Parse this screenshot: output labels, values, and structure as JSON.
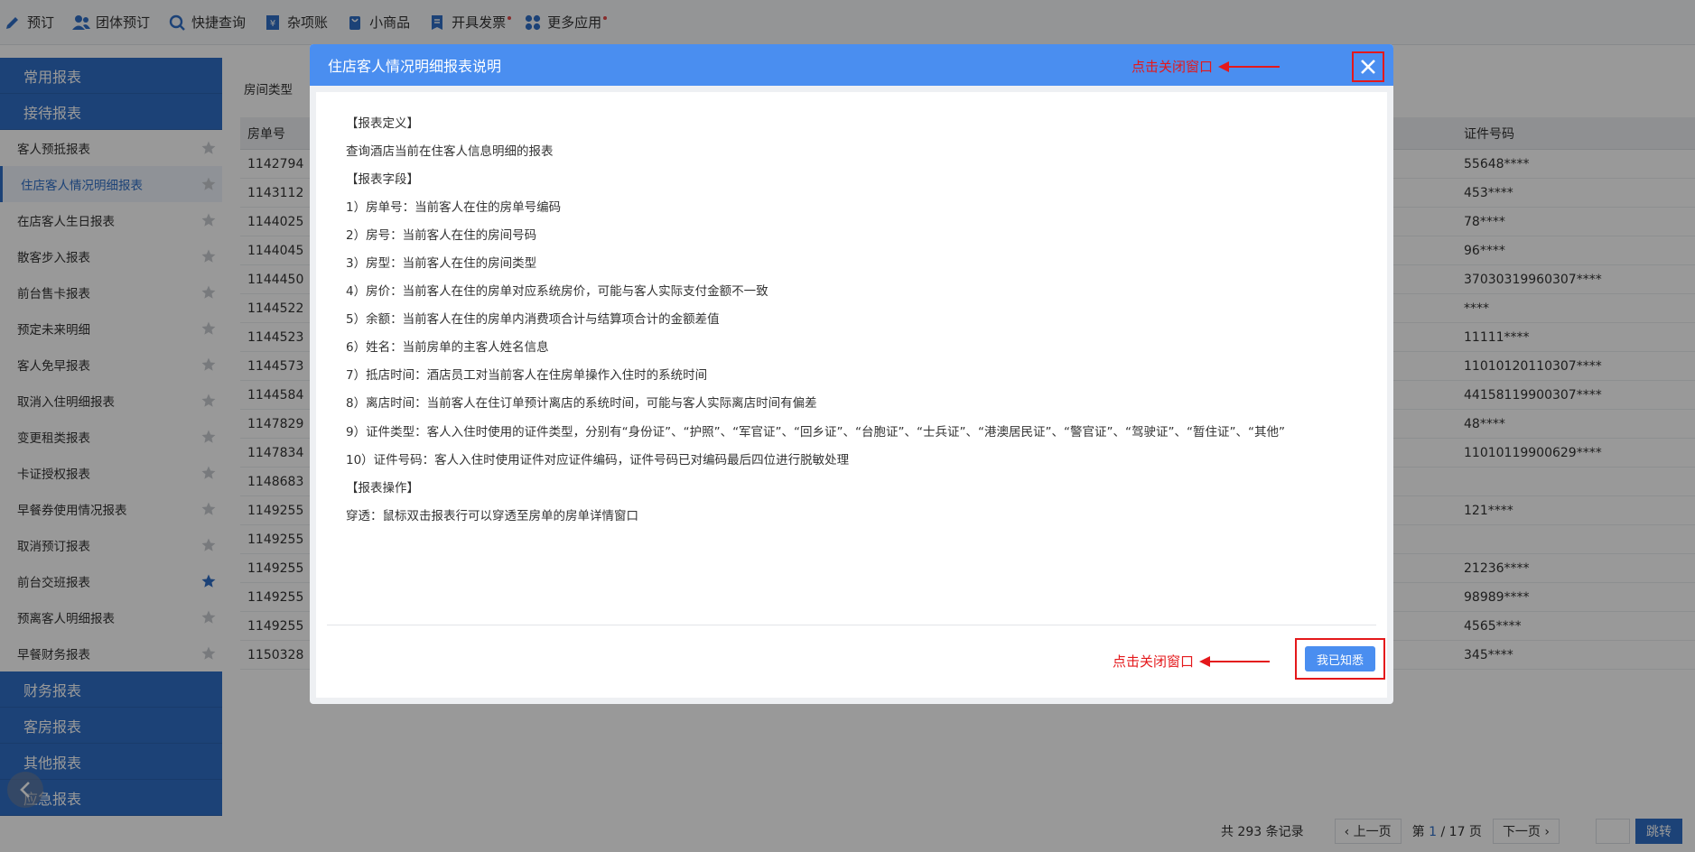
{
  "toolbar": {
    "items": [
      {
        "label": "预订",
        "icon": "pencil-icon"
      },
      {
        "label": "团体预订",
        "icon": "group-icon"
      },
      {
        "label": "快捷查询",
        "icon": "search-icon"
      },
      {
        "label": "杂项账",
        "icon": "ledger-icon"
      },
      {
        "label": "小商品",
        "icon": "bag-icon"
      },
      {
        "label": "开具发票",
        "icon": "invoice-icon"
      },
      {
        "label": "更多应用",
        "icon": "apps-icon"
      }
    ]
  },
  "sidebar": {
    "top_categories": [
      "常用报表",
      "接待报表"
    ],
    "items": [
      {
        "label": "客人预抵报表",
        "starred": false
      },
      {
        "label": "住店客人情况明细报表",
        "starred": false,
        "active": true
      },
      {
        "label": "在店客人生日报表",
        "starred": false
      },
      {
        "label": "散客步入报表",
        "starred": false
      },
      {
        "label": "前台售卡报表",
        "starred": false
      },
      {
        "label": "预定未来明细",
        "starred": false
      },
      {
        "label": "客人免早报表",
        "starred": false
      },
      {
        "label": "取消入住明细报表",
        "starred": false
      },
      {
        "label": "变更租类报表",
        "starred": false
      },
      {
        "label": "卡证授权报表",
        "starred": false
      },
      {
        "label": "早餐券使用情况报表",
        "starred": false
      },
      {
        "label": "取消预订报表",
        "starred": false
      },
      {
        "label": "前台交班报表",
        "starred": true
      },
      {
        "label": "预离客人明细报表",
        "starred": false
      },
      {
        "label": "早餐财务报表",
        "starred": false
      }
    ],
    "bottom_categories": [
      "财务报表",
      "客房报表",
      "其他报表",
      "应急报表"
    ]
  },
  "main": {
    "filter_label": "房间类型",
    "columns": [
      "房单号",
      "证件号码"
    ],
    "rows": [
      [
        "1142794",
        "55648****"
      ],
      [
        "1143112",
        "453****"
      ],
      [
        "1144025",
        "78****"
      ],
      [
        "1144045",
        "96****"
      ],
      [
        "1144450",
        "37030319960307****"
      ],
      [
        "1144522",
        "****"
      ],
      [
        "1144523",
        "11111****"
      ],
      [
        "1144573",
        "11010120110307****"
      ],
      [
        "1144584",
        "44158119900307****"
      ],
      [
        "1147829",
        "48****"
      ],
      [
        "1147834",
        "11010119900629****"
      ],
      [
        "1148683",
        ""
      ],
      [
        "1149255",
        "121****"
      ],
      [
        "1149255",
        ""
      ],
      [
        "1149255",
        "21236****"
      ],
      [
        "1149255",
        "98989****"
      ],
      [
        "1149255",
        "4565****"
      ],
      [
        "1150328",
        "345****"
      ]
    ]
  },
  "pager": {
    "total": "共 293 条记录",
    "prev": "‹ 上一页",
    "page_prefix": "第",
    "page_current": "1",
    "page_suffix": "/ 17 页",
    "next": "下一页 ›",
    "jump": "跳转"
  },
  "modal": {
    "title": "住店客人情况明细报表说明",
    "close_annotation": "点击关闭窗口",
    "confirm_annotation": "点击关闭窗口",
    "confirm_label": "我已知悉",
    "lines": [
      "【报表定义】",
      "查询酒店当前在住客人信息明细的报表",
      "【报表字段】",
      "1）房单号：当前客人在住的房单号编码",
      "2）房号：当前客人在住的房间号码",
      "3）房型：当前客人在住的房间类型",
      "4）房价：当前客人在住的房单对应系统房价，可能与客人实际支付金额不一致",
      "5）余额：当前客人在住的房单内消费项合计与结算项合计的金额差值",
      "6）姓名：当前房单的主客人姓名信息",
      "7）抵店时间：酒店员工对当前客人在住房单操作入住时的系统时间",
      "8）离店时间：当前客人在住订单预计离店的系统时间，可能与客人实际离店时间有偏差",
      "9）证件类型：客人入住时使用的证件类型，分别有“身份证”、“护照”、“军官证”、“回乡证”、“台胞证”、“士兵证”、“港澳居民证”、“警官证”、“驾驶证”、“暂住证”、“其他”",
      "10）证件号码：客人入住时使用证件对应证件编码，证件号码已对编码最后四位进行脱敏处理",
      "【报表操作】",
      "穿透：鼠标双击报表行可以穿透至房单的房单详情窗口"
    ]
  },
  "colors": {
    "sidebar_blue": "#2f6fc7",
    "modal_header": "#4a8ef0",
    "annotation_red": "#e4181b"
  }
}
